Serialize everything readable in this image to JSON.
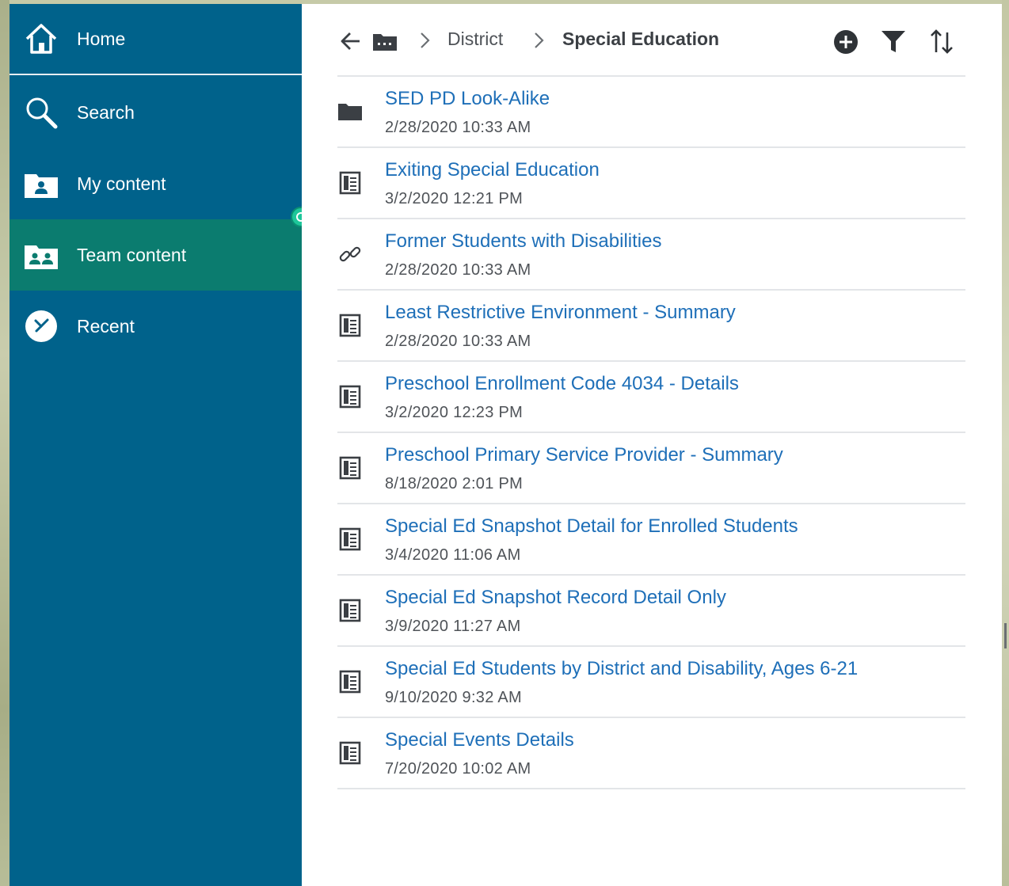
{
  "colors": {
    "sidebar": "#00628b",
    "sidebar_active": "#0b7c6f",
    "link": "#1e6fb8",
    "text_muted": "#4f5358"
  },
  "sidebar": {
    "items": [
      {
        "label": "Home",
        "icon": "home-icon"
      },
      {
        "label": "Search",
        "icon": "search-icon"
      },
      {
        "label": "My content",
        "icon": "my-content-folder-icon"
      },
      {
        "label": "Team content",
        "icon": "team-content-folder-icon",
        "active": true
      },
      {
        "label": "Recent",
        "icon": "recent-clock-icon"
      }
    ]
  },
  "toolbar": {
    "breadcrumb": [
      "District",
      "Special Education"
    ],
    "icons": [
      "back-arrow-icon",
      "folder-icon",
      "add-icon",
      "filter-icon",
      "sort-icon"
    ]
  },
  "items": [
    {
      "title": "SED PD Look-Alike",
      "date": "2/28/2020 10:33 AM",
      "type": "folder"
    },
    {
      "title": "Exiting Special Education",
      "date": "3/2/2020 12:21 PM",
      "type": "report"
    },
    {
      "title": "Former Students with Disabilities",
      "date": "2/28/2020 10:33 AM",
      "type": "link"
    },
    {
      "title": "Least Restrictive Environment - Summary",
      "date": "2/28/2020 10:33 AM",
      "type": "report"
    },
    {
      "title": "Preschool Enrollment Code 4034 - Details",
      "date": "3/2/2020 12:23 PM",
      "type": "report"
    },
    {
      "title": "Preschool Primary Service Provider - Summary",
      "date": "8/18/2020 2:01 PM",
      "type": "report"
    },
    {
      "title": "Special Ed Snapshot Detail for Enrolled Students",
      "date": "3/4/2020 11:06 AM",
      "type": "report"
    },
    {
      "title": "Special Ed Snapshot Record Detail Only",
      "date": "3/9/2020 11:27 AM",
      "type": "report"
    },
    {
      "title": "Special Ed Students by District and Disability, Ages 6-21",
      "date": "9/10/2020 9:32 AM",
      "type": "report"
    },
    {
      "title": "Special Events Details",
      "date": "7/20/2020 10:02 AM",
      "type": "report"
    }
  ]
}
